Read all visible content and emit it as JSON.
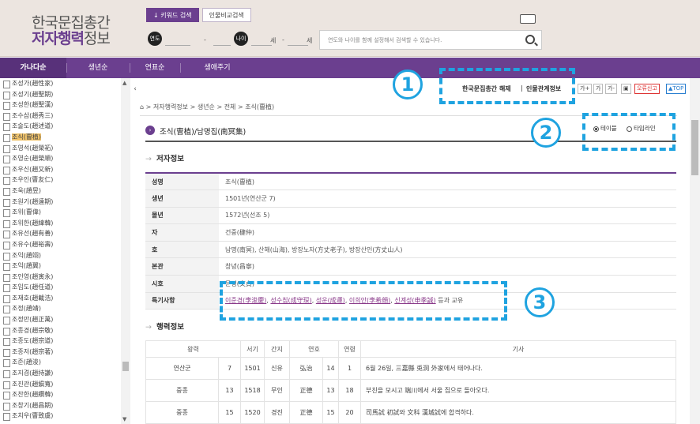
{
  "header": {
    "logo_line1": "한국문집총간",
    "logo_line2_bold": "저자행력",
    "logo_line2_rest": "정보",
    "tabs": [
      {
        "label": "↓ 키워드 검색",
        "active": true
      },
      {
        "label": "인물비교검색",
        "active": false
      }
    ],
    "year_label": "연도",
    "year_sep": "-",
    "age_label": "나이",
    "age_unit1": "세",
    "age_sep": "-",
    "age_unit2": "세",
    "search_placeholder": "연도와 나이를 함께 설정해서 검색할 수 있습니다."
  },
  "nav": {
    "items": [
      "가나다순",
      "생년순",
      "연표순",
      "생애주기"
    ]
  },
  "sidebar": {
    "items": [
      {
        "label": "조성가(趙性家)"
      },
      {
        "label": "조성기(趙聖期)"
      },
      {
        "label": "조성한(趙聖漢)"
      },
      {
        "label": "조수삼(趙秀三)"
      },
      {
        "label": "조술도(趙述道)"
      },
      {
        "label": "조식(曺植)",
        "highlight": true
      },
      {
        "label": "조영석(趙榮祏)"
      },
      {
        "label": "조영순(趙榮順)"
      },
      {
        "label": "조우신(趙又新)"
      },
      {
        "label": "조우인(曺友仁)"
      },
      {
        "label": "조욱(趙昱)"
      },
      {
        "label": "조원기(趙遠期)"
      },
      {
        "label": "조위(曺偉)"
      },
      {
        "label": "조위한(趙緯韓)"
      },
      {
        "label": "조유선(趙有善)"
      },
      {
        "label": "조유수(趙裕壽)"
      },
      {
        "label": "조익(趙翊)"
      },
      {
        "label": "조익(趙翼)"
      },
      {
        "label": "조인영(趙寅永)"
      },
      {
        "label": "조임도(趙任道)"
      },
      {
        "label": "조재호(趙載浩)"
      },
      {
        "label": "조정(趙靖)"
      },
      {
        "label": "조정만(趙正萬)"
      },
      {
        "label": "조종경(趙宗敬)"
      },
      {
        "label": "조종도(趙宗道)"
      },
      {
        "label": "조종저(趙宗著)"
      },
      {
        "label": "조준(趙浚)"
      },
      {
        "label": "조지겸(趙持謙)"
      },
      {
        "label": "조진관(趙鎭寬)"
      },
      {
        "label": "조찬한(趙纘韓)"
      },
      {
        "label": "조창기(趙昌期)"
      },
      {
        "label": "조치우(曺致虞)"
      }
    ]
  },
  "toolbar": {
    "link1": "한국문집총간 해제",
    "separator": "|",
    "link2": "인물관계정보",
    "font_plus": "가+",
    "font_normal": "가",
    "font_minus": "가-",
    "error_report": "오류신고",
    "top": "▲TOP"
  },
  "breadcrumb": "> 저자행력정보 > 생년순 > 전체 > 조식(曺植)",
  "title": "조식(曺植)/남명집(南冥集)",
  "view_options": [
    {
      "label": "테이블",
      "checked": true
    },
    {
      "label": "타임라인",
      "checked": false
    }
  ],
  "author_section": "저자정보",
  "author_info": [
    {
      "key": "성명",
      "value": "조식(曺植)"
    },
    {
      "key": "생년",
      "value": "1501년(연산군 7)"
    },
    {
      "key": "몰년",
      "value": "1572년(선조 5)"
    },
    {
      "key": "자",
      "value": "건중(楗仲)"
    },
    {
      "key": "호",
      "value": "남명(南冥), 산해(山海), 방장노자(方丈老子), 방장산인(方丈山人)"
    },
    {
      "key": "본관",
      "value": "창녕(昌寧)"
    },
    {
      "key": "시호",
      "value": "문정(文貞)"
    },
    {
      "key": "특기사항",
      "value": ""
    }
  ],
  "relations": {
    "people": [
      "이준경(李浚慶)",
      "성수침(成守琛)",
      "성운(成運)",
      "이희안(李希顔)",
      "신계성(申季誠)"
    ],
    "suffix": "등과 교유"
  },
  "activity_section": "행력정보",
  "activity": {
    "headers": [
      "왕력",
      "서기",
      "간지",
      "연호",
      "연령",
      "기사"
    ],
    "rows": [
      {
        "king": "연산군",
        "reign_year": "7",
        "year": "1501",
        "ganji": "신유",
        "era": "弘治",
        "era_year": "14",
        "age": "1",
        "event": "6월 26일, 三嘉縣 兎洞 外家에서 태어나다."
      },
      {
        "king": "중종",
        "reign_year": "13",
        "year": "1518",
        "ganji": "무인",
        "era": "正德",
        "era_year": "13",
        "age": "18",
        "event": "부친을 모시고 端川에서 서울 집으로 돌아오다."
      },
      {
        "king": "중종",
        "reign_year": "15",
        "year": "1520",
        "ganji": "경진",
        "era": "正德",
        "era_year": "15",
        "age": "20",
        "event": "司馬試 初試와 文科 漢城試에 합격하다."
      }
    ]
  },
  "annotations": [
    "1",
    "2",
    "3"
  ],
  "colors": {
    "brand": "#6b3f8f",
    "annotation": "#1fa3e0",
    "highlight": "#f0c36b"
  }
}
